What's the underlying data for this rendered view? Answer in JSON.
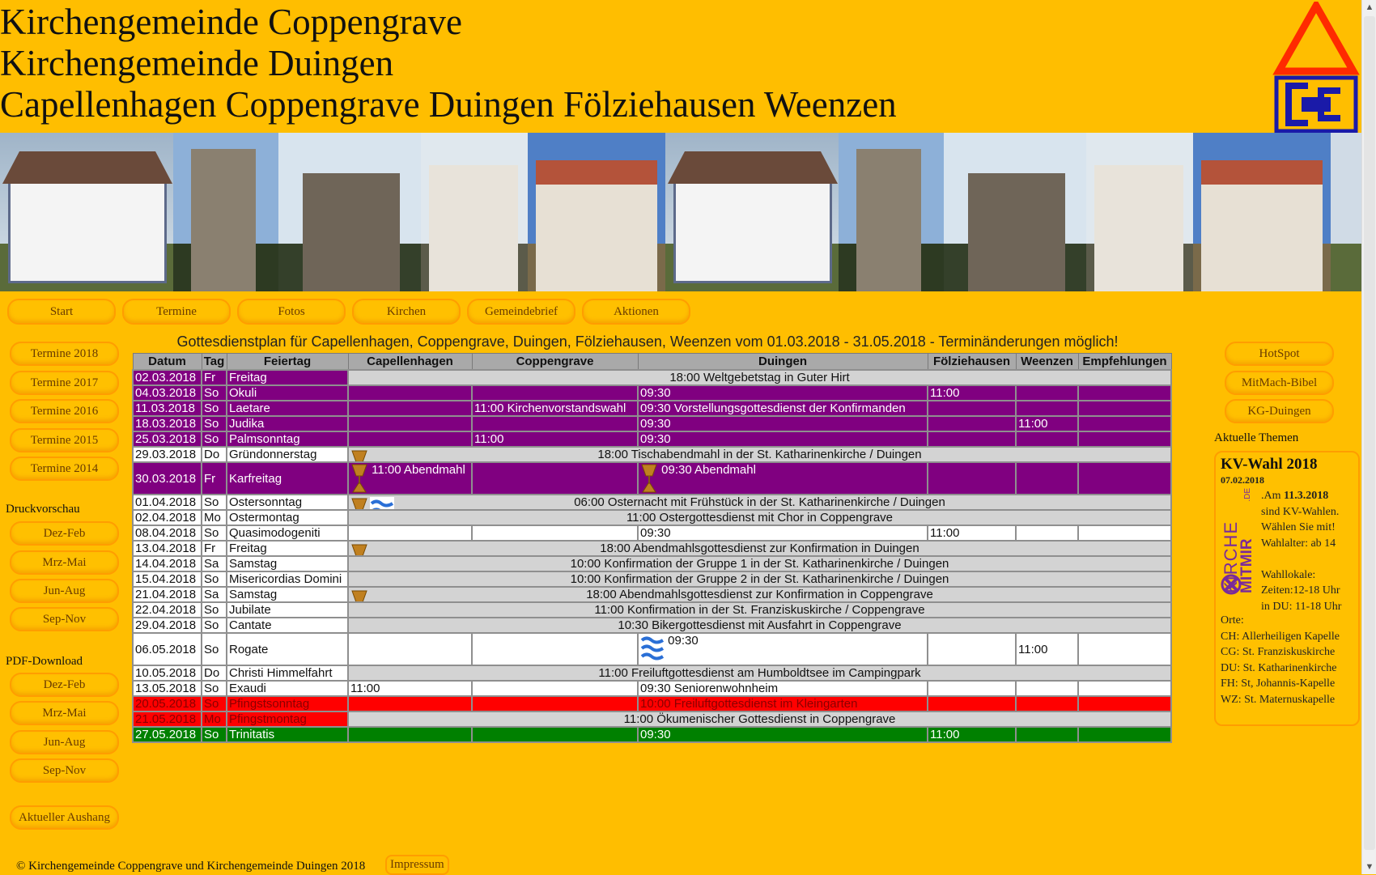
{
  "header": {
    "line1": "Kirchengemeinde Coppengrave",
    "line2": "Kirchengemeinde Duingen",
    "line3": "Capellenhagen Coppengrave Duingen Fölziehausen Weenzen"
  },
  "nav": [
    "Start",
    "Termine",
    "Fotos",
    "Kirchen",
    "Gemeindebrief",
    "Aktionen"
  ],
  "left_sidebar": {
    "termine": [
      "Termine 2018",
      "Termine 2017",
      "Termine 2016",
      "Termine 2015",
      "Termine 2014"
    ],
    "druck_label": "Druckvorschau",
    "druck": [
      "Dez-Feb",
      "Mrz-Mai",
      "Jun-Aug",
      "Sep-Nov"
    ],
    "pdf_label": "PDF-Download",
    "pdf": [
      "Dez-Feb",
      "Mrz-Mai",
      "Jun-Aug",
      "Sep-Nov"
    ],
    "aushang": "Aktueller Aushang"
  },
  "plan": {
    "title": "Gottesdienstplan für Capellenhagen, Coppengrave, Duingen, Fölziehausen, Weenzen vom 01.03.2018 - 31.05.2018 - Terminänderungen möglich!",
    "headers": [
      "Datum",
      "Tag",
      "Feiertag",
      "Capellenhagen",
      "Coppengrave",
      "Duingen",
      "Fölziehausen",
      "Weenzen",
      "Empfehlungen"
    ],
    "rows": [
      {
        "datum": "02.03.2018",
        "tag": "Fr",
        "feiertag": "Freitag",
        "merged": "18:00 Weltgebetstag in Guter Hirt"
      },
      {
        "datum": "04.03.2018",
        "tag": "So",
        "feiertag": "Okuli",
        "duingen": "09:30",
        "foelz": "11:00"
      },
      {
        "datum": "11.03.2018",
        "tag": "So",
        "feiertag": "Laetare",
        "copp": "11:00 Kirchenvorstandswahl",
        "duingen": "09:30 Vorstellungsgottesdienst der Konfirmanden"
      },
      {
        "datum": "18.03.2018",
        "tag": "So",
        "feiertag": "Judika",
        "duingen": "09:30",
        "weenzen": "11:00"
      },
      {
        "datum": "25.03.2018",
        "tag": "So",
        "feiertag": "Palmsonntag",
        "copp": "11:00",
        "duingen": "09:30"
      },
      {
        "datum": "29.03.2018",
        "tag": "Do",
        "feiertag": "Gründonnerstag",
        "merged": "18:00 Tischabendmahl in der St. Katharinenkirche / Duingen"
      },
      {
        "datum": "30.03.2018",
        "tag": "Fr",
        "feiertag": "Karfreitag",
        "capel": "11:00 Abendmahl",
        "duingen": "09:30 Abendmahl"
      },
      {
        "datum": "01.04.2018",
        "tag": "So",
        "feiertag": "Ostersonntag",
        "merged": "06:00 Osternacht mit Frühstück in der St. Katharinenkirche / Duingen"
      },
      {
        "datum": "02.04.2018",
        "tag": "Mo",
        "feiertag": "Ostermontag",
        "merged": "11:00 Ostergottesdienst mit Chor in Coppengrave"
      },
      {
        "datum": "08.04.2018",
        "tag": "So",
        "feiertag": "Quasimodogeniti",
        "duingen": "09:30",
        "foelz": "11:00"
      },
      {
        "datum": "13.04.2018",
        "tag": "Fr",
        "feiertag": "Freitag",
        "merged": "18:00 Abendmahlsgottesdienst zur Konfirmation in Duingen"
      },
      {
        "datum": "14.04.2018",
        "tag": "Sa",
        "feiertag": "Samstag",
        "merged": "10:00 Konfirmation der Gruppe 1 in der St. Katharinenkirche / Duingen"
      },
      {
        "datum": "15.04.2018",
        "tag": "So",
        "feiertag": "Misericordias Domini",
        "merged": "10:00 Konfirmation der Gruppe 2 in der St. Katharinenkirche / Duingen"
      },
      {
        "datum": "21.04.2018",
        "tag": "Sa",
        "feiertag": "Samstag",
        "merged": "18:00 Abendmahlsgottesdienst zur Konfirmation in Coppengrave"
      },
      {
        "datum": "22.04.2018",
        "tag": "So",
        "feiertag": "Jubilate",
        "merged": "11:00 Konfirmation in der St. Franziskuskirche / Coppengrave"
      },
      {
        "datum": "29.04.2018",
        "tag": "So",
        "feiertag": "Cantate",
        "merged": "10:30 Bikergottesdienst mit Ausfahrt in Coppengrave"
      },
      {
        "datum": "06.05.2018",
        "tag": "So",
        "feiertag": "Rogate",
        "duingen": "09:30",
        "weenzen": "11:00"
      },
      {
        "datum": "10.05.2018",
        "tag": "Do",
        "feiertag": "Christi Himmelfahrt",
        "merged": "11:00 Freiluftgottesdienst am Humboldtsee im Campingpark"
      },
      {
        "datum": "13.05.2018",
        "tag": "So",
        "feiertag": "Exaudi",
        "capel": "11:00",
        "duingen": "09:30 Seniorenwohnheim"
      },
      {
        "datum": "20.05.2018",
        "tag": "So",
        "feiertag": "Pfingstsonntag",
        "duingen": "10:00 Freiluftgottesdienst im Kleingarten"
      },
      {
        "datum": "21.05.2018",
        "tag": "Mo",
        "feiertag": "Pfingstmontag",
        "merged": "11:00 Ökumenischer Gottesdienst in Coppengrave"
      },
      {
        "datum": "27.05.2018",
        "tag": "So",
        "feiertag": "Trinitatis",
        "duingen": "09:30",
        "foelz": "11:00"
      }
    ]
  },
  "right_sidebar": {
    "buttons": [
      "HotSpot",
      "MitMach-Bibel",
      "KG-Duingen"
    ],
    "themen_label": "Aktuelle Themen",
    "news_title": "KV-Wahl 2018",
    "news_date": "07.02.2018",
    "logo_text_1": "KIRCHE",
    "logo_text_2": "MITMIR",
    "logo_text_3": ".DE",
    "news_lines": [
      ".Am",
      "11.3.2018",
      "sind KV-Wahlen.",
      "Wählen Sie mit!",
      "Wahlalter: ab 14",
      "Wahllokale:",
      "Zeiten:12-18 Uhr",
      "in DU: 11-18 Uhr"
    ],
    "orte_label": "Orte:",
    "orte": [
      "CH: Allerheiligen Kapelle",
      "CG: St. Franziskuskirche",
      "DU: St. Katharinenkirche",
      "FH: St, Johannis-Kapelle",
      "WZ: St. Maternuskapelle"
    ]
  },
  "footer": {
    "copyright": "© Kirchengemeinde Coppengrave und Kirchengemeinde Duingen 2018",
    "impressum": "Impressum"
  },
  "colors": {
    "page_bg": "#FFBE00",
    "violet_row": "#800080",
    "grey_row": "#D3D3D3",
    "red_row": "#FF0000",
    "green_row": "#008000",
    "logo_red": "#FF2A00",
    "logo_blue": "#1a1aa8"
  },
  "icons": [
    "chalice-icon",
    "fish-wave-icon",
    "logo-triangle-icon",
    "logo-cc-icon"
  ]
}
